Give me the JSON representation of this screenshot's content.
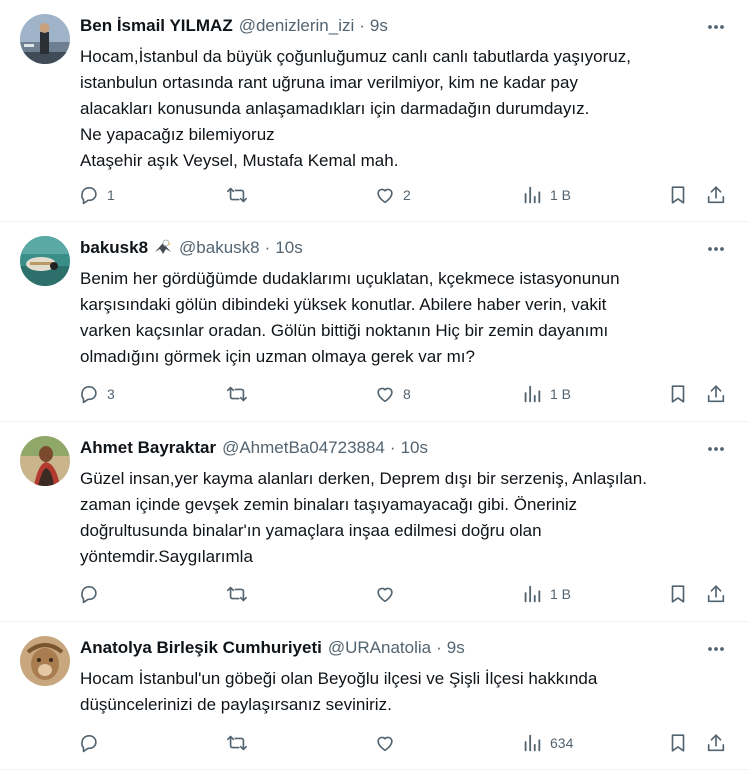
{
  "tweets": [
    {
      "display_name": "Ben İsmail YILMAZ",
      "handle": "@denizlerin_izi",
      "dot": "·",
      "time": "9s",
      "text": "Hocam,İstanbul da büyük çoğunluğumuz canlı canlı tabutlarda yaşıyoruz,\nistanbulun ortasında rant uğruna imar verilmiyor, kim ne kadar pay\nalacakları konusunda anlaşamadıkları için darmadağın durumdayız.\nNe yapacağız bilemiyoruz\nAtaşehir aşık Veysel, Mustafa Kemal mah.",
      "replies": "1",
      "retweets": "",
      "likes": "2",
      "views": "1 B"
    },
    {
      "display_name": "bakusk8",
      "handle": "@bakusk8",
      "dot": "·",
      "time": "10s",
      "text": "Benim her gördüğümde dudaklarımı uçuklatan, kçekmece istasyonunun\nkarşısındaki gölün dibindeki yüksek konutlar. Abilere haber verin, vakit\nvarken kaçsınlar oradan. Gölün bittiği noktanın Hiç bir zemin dayanımı\nolmadığını görmek için uzman olmaya gerek var mı?",
      "replies": "3",
      "retweets": "",
      "likes": "8",
      "views": "1 B"
    },
    {
      "display_name": "Ahmet Bayraktar",
      "handle": "@AhmetBa04723884",
      "dot": "·",
      "time": "10s",
      "text": "Güzel insan,yer kayma alanları derken, Deprem dışı bir  serzeniş, Anlaşılan.\nzaman içinde  gevşek zemin binaları taşıyamayacağı gibi. Öneriniz\ndoğrultusunda binalar'ın yamaçlara inşaa edilmesi doğru olan\nyöntemdir.Saygılarımla",
      "replies": "",
      "retweets": "",
      "likes": "",
      "views": "1 B"
    },
    {
      "display_name": "Anatolya Birleşik Cumhuriyeti",
      "handle": "@URAnatolia",
      "dot": "·",
      "time": "9s",
      "text": "Hocam İstanbul'un göbeği olan Beyoğlu ilçesi ve Şişli İlçesi hakkında\ndüşüncelerinizi de paylaşırsanız seviniriz.",
      "replies": "",
      "retweets": "",
      "likes": "",
      "views": "634"
    }
  ],
  "icons": {
    "more": "more-dots-icon",
    "reply": "reply-bubble-icon",
    "retweet": "retweet-arrows-icon",
    "like": "heart-icon",
    "views": "views-bar-chart-icon",
    "bookmark": "bookmark-icon",
    "share": "share-upload-icon",
    "badge": "eagle-emoji-icon"
  },
  "colors": {
    "text": "#0f1419",
    "secondary": "#536471",
    "divider": "#eff3f4",
    "background": "#ffffff"
  }
}
